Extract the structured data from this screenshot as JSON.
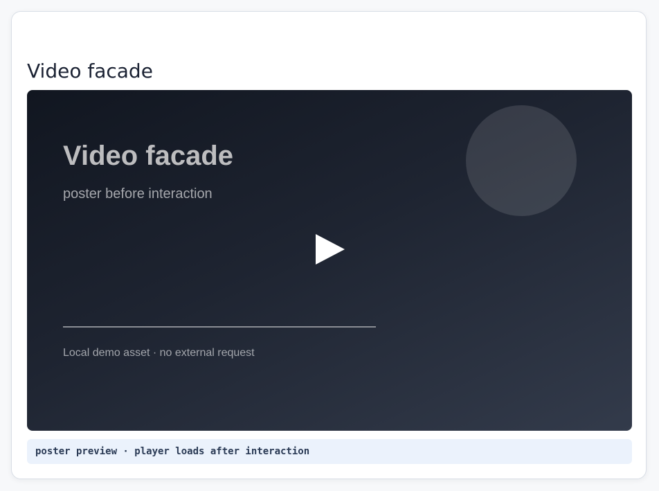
{
  "section": {
    "title": "Video facade"
  },
  "video": {
    "poster_title": "Video facade",
    "poster_subtitle": "poster before interaction",
    "asset_note": "Local demo asset · no external request",
    "play_icon": "play-icon"
  },
  "caption": {
    "text": "poster preview · player loads after interaction"
  },
  "colors": {
    "card_background": "#ffffff",
    "video_gradient_start": "#111620",
    "video_gradient_end": "#333b4b",
    "caption_background": "#ebf2fc",
    "caption_text": "#2a3a55"
  }
}
